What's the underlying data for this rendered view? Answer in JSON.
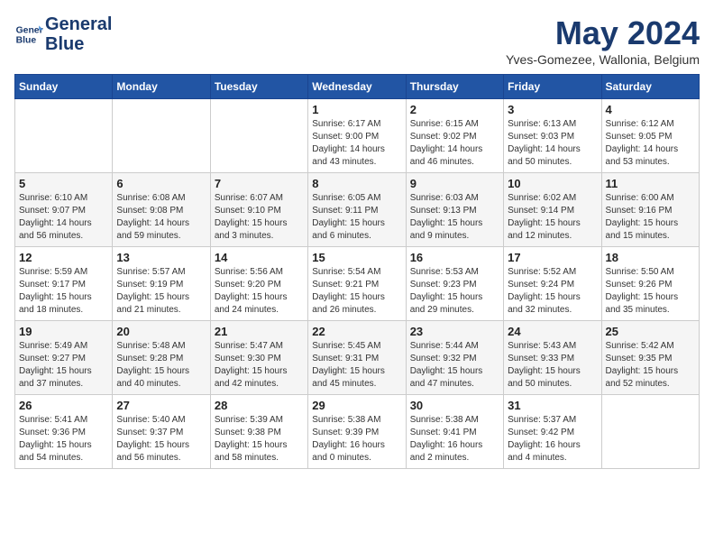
{
  "header": {
    "logo_line1": "General",
    "logo_line2": "Blue",
    "month_title": "May 2024",
    "location": "Yves-Gomezee, Wallonia, Belgium"
  },
  "weekdays": [
    "Sunday",
    "Monday",
    "Tuesday",
    "Wednesday",
    "Thursday",
    "Friday",
    "Saturday"
  ],
  "weeks": [
    [
      {
        "day": "",
        "info": ""
      },
      {
        "day": "",
        "info": ""
      },
      {
        "day": "",
        "info": ""
      },
      {
        "day": "1",
        "info": "Sunrise: 6:17 AM\nSunset: 9:00 PM\nDaylight: 14 hours\nand 43 minutes."
      },
      {
        "day": "2",
        "info": "Sunrise: 6:15 AM\nSunset: 9:02 PM\nDaylight: 14 hours\nand 46 minutes."
      },
      {
        "day": "3",
        "info": "Sunrise: 6:13 AM\nSunset: 9:03 PM\nDaylight: 14 hours\nand 50 minutes."
      },
      {
        "day": "4",
        "info": "Sunrise: 6:12 AM\nSunset: 9:05 PM\nDaylight: 14 hours\nand 53 minutes."
      }
    ],
    [
      {
        "day": "5",
        "info": "Sunrise: 6:10 AM\nSunset: 9:07 PM\nDaylight: 14 hours\nand 56 minutes."
      },
      {
        "day": "6",
        "info": "Sunrise: 6:08 AM\nSunset: 9:08 PM\nDaylight: 14 hours\nand 59 minutes."
      },
      {
        "day": "7",
        "info": "Sunrise: 6:07 AM\nSunset: 9:10 PM\nDaylight: 15 hours\nand 3 minutes."
      },
      {
        "day": "8",
        "info": "Sunrise: 6:05 AM\nSunset: 9:11 PM\nDaylight: 15 hours\nand 6 minutes."
      },
      {
        "day": "9",
        "info": "Sunrise: 6:03 AM\nSunset: 9:13 PM\nDaylight: 15 hours\nand 9 minutes."
      },
      {
        "day": "10",
        "info": "Sunrise: 6:02 AM\nSunset: 9:14 PM\nDaylight: 15 hours\nand 12 minutes."
      },
      {
        "day": "11",
        "info": "Sunrise: 6:00 AM\nSunset: 9:16 PM\nDaylight: 15 hours\nand 15 minutes."
      }
    ],
    [
      {
        "day": "12",
        "info": "Sunrise: 5:59 AM\nSunset: 9:17 PM\nDaylight: 15 hours\nand 18 minutes."
      },
      {
        "day": "13",
        "info": "Sunrise: 5:57 AM\nSunset: 9:19 PM\nDaylight: 15 hours\nand 21 minutes."
      },
      {
        "day": "14",
        "info": "Sunrise: 5:56 AM\nSunset: 9:20 PM\nDaylight: 15 hours\nand 24 minutes."
      },
      {
        "day": "15",
        "info": "Sunrise: 5:54 AM\nSunset: 9:21 PM\nDaylight: 15 hours\nand 26 minutes."
      },
      {
        "day": "16",
        "info": "Sunrise: 5:53 AM\nSunset: 9:23 PM\nDaylight: 15 hours\nand 29 minutes."
      },
      {
        "day": "17",
        "info": "Sunrise: 5:52 AM\nSunset: 9:24 PM\nDaylight: 15 hours\nand 32 minutes."
      },
      {
        "day": "18",
        "info": "Sunrise: 5:50 AM\nSunset: 9:26 PM\nDaylight: 15 hours\nand 35 minutes."
      }
    ],
    [
      {
        "day": "19",
        "info": "Sunrise: 5:49 AM\nSunset: 9:27 PM\nDaylight: 15 hours\nand 37 minutes."
      },
      {
        "day": "20",
        "info": "Sunrise: 5:48 AM\nSunset: 9:28 PM\nDaylight: 15 hours\nand 40 minutes."
      },
      {
        "day": "21",
        "info": "Sunrise: 5:47 AM\nSunset: 9:30 PM\nDaylight: 15 hours\nand 42 minutes."
      },
      {
        "day": "22",
        "info": "Sunrise: 5:45 AM\nSunset: 9:31 PM\nDaylight: 15 hours\nand 45 minutes."
      },
      {
        "day": "23",
        "info": "Sunrise: 5:44 AM\nSunset: 9:32 PM\nDaylight: 15 hours\nand 47 minutes."
      },
      {
        "day": "24",
        "info": "Sunrise: 5:43 AM\nSunset: 9:33 PM\nDaylight: 15 hours\nand 50 minutes."
      },
      {
        "day": "25",
        "info": "Sunrise: 5:42 AM\nSunset: 9:35 PM\nDaylight: 15 hours\nand 52 minutes."
      }
    ],
    [
      {
        "day": "26",
        "info": "Sunrise: 5:41 AM\nSunset: 9:36 PM\nDaylight: 15 hours\nand 54 minutes."
      },
      {
        "day": "27",
        "info": "Sunrise: 5:40 AM\nSunset: 9:37 PM\nDaylight: 15 hours\nand 56 minutes."
      },
      {
        "day": "28",
        "info": "Sunrise: 5:39 AM\nSunset: 9:38 PM\nDaylight: 15 hours\nand 58 minutes."
      },
      {
        "day": "29",
        "info": "Sunrise: 5:38 AM\nSunset: 9:39 PM\nDaylight: 16 hours\nand 0 minutes."
      },
      {
        "day": "30",
        "info": "Sunrise: 5:38 AM\nSunset: 9:41 PM\nDaylight: 16 hours\nand 2 minutes."
      },
      {
        "day": "31",
        "info": "Sunrise: 5:37 AM\nSunset: 9:42 PM\nDaylight: 16 hours\nand 4 minutes."
      },
      {
        "day": "",
        "info": ""
      }
    ]
  ]
}
